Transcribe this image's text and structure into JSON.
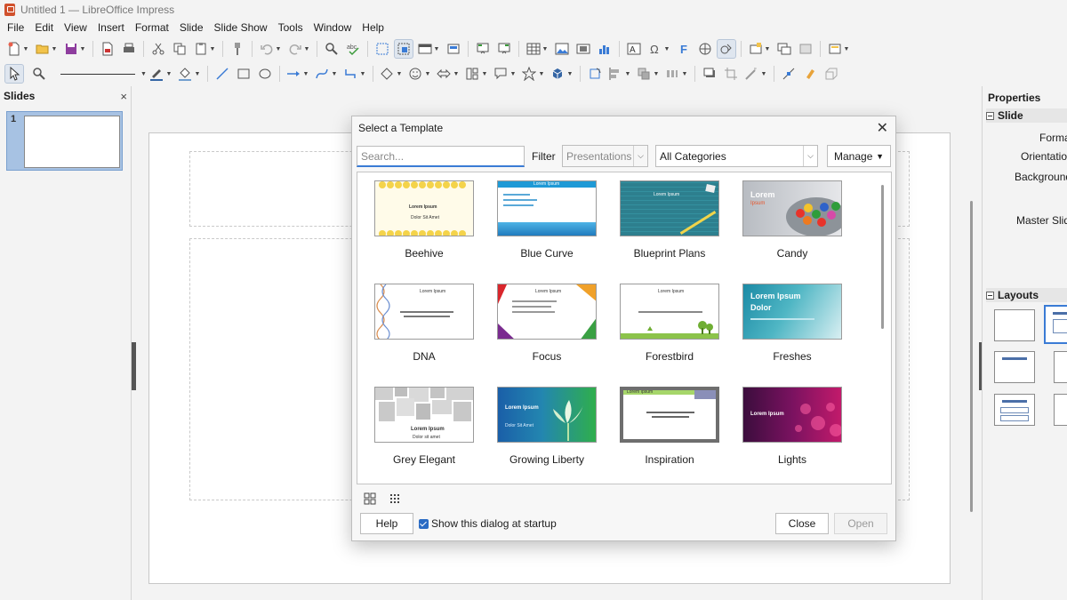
{
  "window": {
    "title": "Untitled 1 — LibreOffice Impress"
  },
  "menu": [
    "File",
    "Edit",
    "View",
    "Insert",
    "Format",
    "Slide",
    "Slide Show",
    "Tools",
    "Window",
    "Help"
  ],
  "slides_pane": {
    "title": "Slides",
    "close": "×",
    "slide_number": "1"
  },
  "properties": {
    "title": "Properties",
    "slide_section": "Slide",
    "format_label": "Format",
    "orientation_label": "Orientation",
    "background_label": "Background",
    "master_label": "Master Slide",
    "layouts_section": "Layouts"
  },
  "dialog": {
    "title": "Select a Template",
    "close": "✕",
    "search_placeholder": "Search...",
    "filter_label": "Filter",
    "filter_value": "Presentations",
    "category_value": "All Categories",
    "manage_label": "Manage",
    "help_label": "Help",
    "startup_label": "Show this dialog at startup",
    "close_label": "Close",
    "open_label": "Open",
    "templates": [
      {
        "name": "Beehive",
        "t1": "Lorem Ipsum",
        "t2": "Dolor Sit Amet"
      },
      {
        "name": "Blue Curve",
        "t1": "Lorem Ipsum",
        "t2": ""
      },
      {
        "name": "Blueprint Plans",
        "t1": "Lorem Ipsum",
        "t2": ""
      },
      {
        "name": "Candy",
        "t1": "Lorem",
        "t2": "Ipsum"
      },
      {
        "name": "DNA",
        "t1": "Lorem Ipsum",
        "t2": ""
      },
      {
        "name": "Focus",
        "t1": "Lorem Ipsum",
        "t2": ""
      },
      {
        "name": "Forestbird",
        "t1": "Lorem Ipsum",
        "t2": ""
      },
      {
        "name": "Freshes",
        "t1": "Lorem Ipsum",
        "t2": "Dolor"
      },
      {
        "name": "Grey Elegant",
        "t1": "Lorem Ipsum",
        "t2": "Dolor sit amet"
      },
      {
        "name": "Growing Liberty",
        "t1": "Lorem Ipsum",
        "t2": "Dolor Sit Amet"
      },
      {
        "name": "Inspiration",
        "t1": "Lorem Ipsum",
        "t2": ""
      },
      {
        "name": "Lights",
        "t1": "Lorem Ipsum",
        "t2": ""
      }
    ]
  }
}
